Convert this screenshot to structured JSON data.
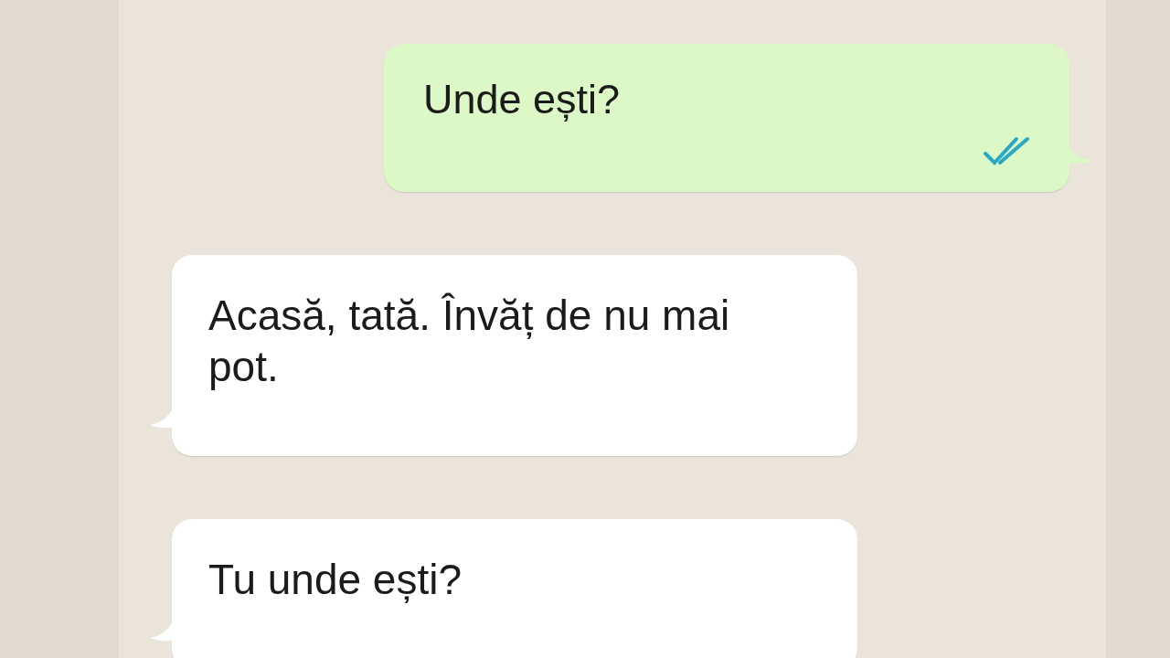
{
  "messages": [
    {
      "kind": "outgoing",
      "text": "Unde ești?",
      "read": true
    },
    {
      "kind": "incoming",
      "text": "Acasă, tată. Învăț de nu mai pot."
    },
    {
      "kind": "incoming",
      "text": "Tu unde ești?"
    }
  ]
}
